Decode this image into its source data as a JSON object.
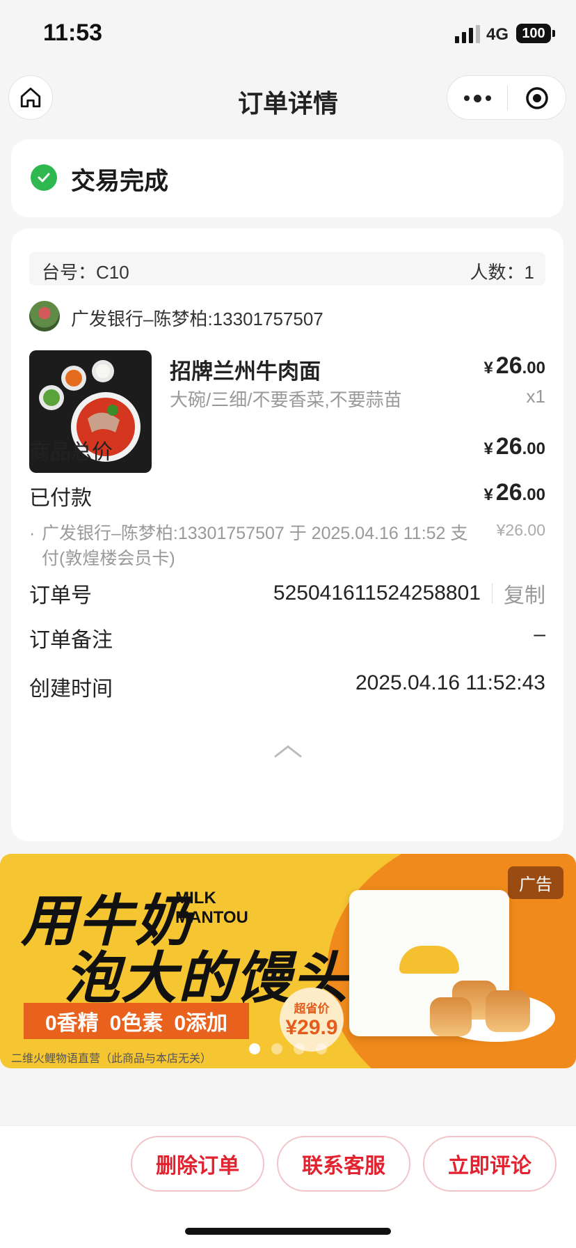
{
  "status_bar": {
    "time": "11:53",
    "network": "4G",
    "battery": "100"
  },
  "nav": {
    "title": "订单详情"
  },
  "order_status": {
    "text": "交易完成"
  },
  "order": {
    "table_no": "台号：C10",
    "people": "人数：1",
    "payer": "广发银行–陈梦柏:13301757507",
    "item": {
      "name": "招牌兰州牛肉面",
      "spec": "大碗/三细/不要香菜,不要蒜苗",
      "price_yen": "¥",
      "price_int": "26",
      "price_dec": ".00",
      "qty": "x1"
    },
    "total_label": "商品总价",
    "total_yen": "¥",
    "total_int": "26",
    "total_dec": ".00",
    "paid_label": "已付款",
    "paid_yen": "¥",
    "paid_int": "26",
    "paid_dec": ".00",
    "paid_detail": "广发银行–陈梦柏:13301757507 于 2025.04.16 11:52 支付(敦煌楼会员卡)",
    "paid_detail_amount": "¥26.00",
    "order_no_label": "订单号",
    "order_no": "525041611524258801",
    "copy_label": "复制",
    "remark_label": "订单备注",
    "remark": "–",
    "created_label": "创建时间",
    "created": "2025.04.16 11:52:43"
  },
  "ad": {
    "badge": "广告",
    "line1": "用牛奶",
    "line2": "泡大的馒头",
    "en1": "MILK",
    "en2": "MANTOU",
    "tag1": "0香精",
    "tag2": "0色素",
    "tag3": "0添加",
    "price_label": "超省价",
    "price": "¥29.9",
    "footer": "二维火鲤物语直营（此商品与本店无关）",
    "pages": 4,
    "active_page": 1
  },
  "actions": {
    "delete": "删除订单",
    "contact": "联系客服",
    "review": "立即评论"
  },
  "colors": {
    "accent": "#e2232f",
    "success": "#2fb84f",
    "ad_bg": "#f6c532",
    "ad_orange": "#f08a1c"
  }
}
